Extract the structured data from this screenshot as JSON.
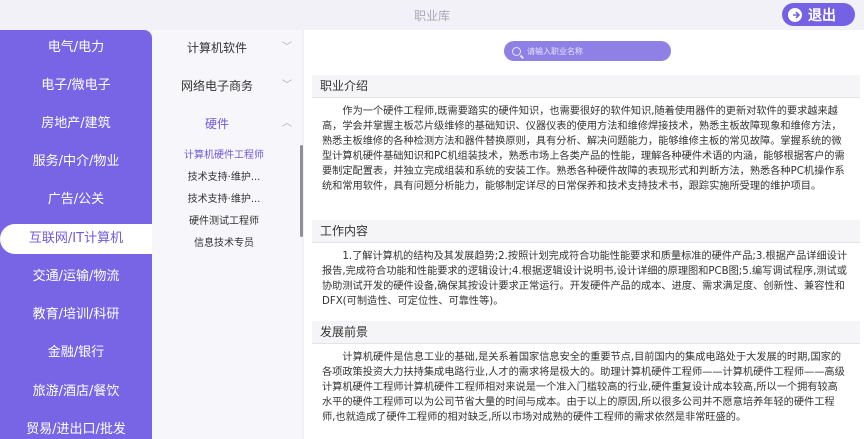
{
  "window": {
    "title": "职业库"
  },
  "exit_button": {
    "label": "退出"
  },
  "industries": [
    "电气/电力",
    "电子/微电子",
    "房地产/建筑",
    "服务/中介/物业",
    "广告/公关",
    "互联网/IT计算机",
    "交通/运输/物流",
    "教育/培训/科研",
    "金融/银行",
    "旅游/酒店/餐饮",
    "贸易/进出口/批发"
  ],
  "active_industry": "互联网/IT计算机",
  "categories": [
    {
      "label": "计算机软件",
      "open": false
    },
    {
      "label": "网络电子商务",
      "open": false
    },
    {
      "label": "硬件",
      "open": true
    }
  ],
  "occupations": [
    "计算机硬件工程师",
    "技术支持·维护...",
    "技术支持·维护...",
    "硬件测试工程师",
    "信息技术专员"
  ],
  "active_occupation": "计算机硬件工程师",
  "search": {
    "placeholder": "请输入职业名称"
  },
  "sections": {
    "intro": {
      "title": "职业介绍",
      "text": "作为一个硬件工程师,既需要踏实的硬件知识，也需要很好的软件知识,随着使用器件的更新对软件的要求越来越高，学会并掌握主板芯片级维修的基础知识、仪器仪表的使用方法和维修焊接技术，熟悉主板故障现象和维修方法，熟悉主板维修的各种检测方法和器件替换原则，具有分析、解决问题能力，能够维修主板的常见故障。掌握系统的微型计算机硬件基础知识和PC机组装技术，熟悉市场上各类产品的性能，理解各种硬件术语的内涵，能够根据客户的需要制定配置表，并独立完成组装和系统的安装工作。熟悉各种硬件故障的表现形式和判断方法，熟悉各种PC机操作系统和常用软件，具有问题分析能力，能够制定详尽的日常保养和技术支持技术书，跟踪实施所受理的维护项目。"
    },
    "work": {
      "title": "工作内容",
      "text": "1.了解计算机的结构及其发展趋势;2.按照计划完成符合功能性能要求和质量标准的硬件产品;3.根据产品详细设计报告,完成符合功能和性能要求的逻辑设计;4.根据逻辑设计说明书,设计详细的原理图和PCB图;5.编写调试程序,测试或协助测试开发的硬件设备,确保其按设计要求正常运行。开发硬件产品的成本、进度、需求满足度、创新性、兼容性和DFX(可制造性、可定位性、可靠性等)。"
    },
    "prospect": {
      "title": "发展前景",
      "text": "计算机硬件是信息工业的基础,是关系着国家信息安全的重要节点,目前国内的集成电路处于大发展的时期,国家的各项政策投资大力扶持集成电路行业,人才的需求将是极大的。助理计算机硬件工程师——计算机硬件工程师——高级计算机硬件工程师计算机硬件工程师相对来说是一个准入门槛较高的行业,硬件重复设计成本较高,所以一个拥有较高水平的硬件工程师可以为公司节省大量的时间与成本。由于以上的原因,所以很多公司并不愿意培养年轻的硬件工程师,也就造成了硬件工程师的相对缺乏,所以市场对成熟的硬件工程师的需求依然是非常旺盛的。"
    }
  },
  "colors": {
    "accent": "#7865e5",
    "active_text": "#6e5bd8"
  }
}
